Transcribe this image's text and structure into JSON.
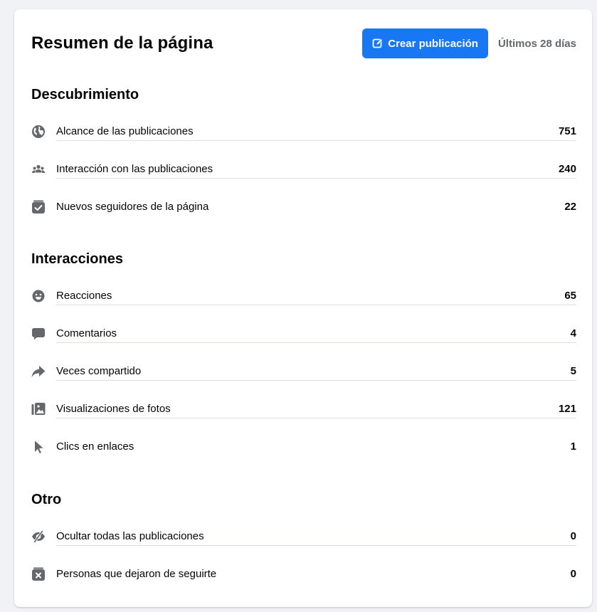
{
  "header": {
    "title": "Resumen de la página",
    "create_button_label": "Crear publicación",
    "period_label": "Últimos 28 días"
  },
  "colors": {
    "accent": "#1877f2",
    "icon": "#65676b",
    "text": "#050505",
    "muted": "#65676b",
    "divider": "#dadde1"
  },
  "sections": [
    {
      "title": "Descubrimiento",
      "rows": [
        {
          "icon": "globe-icon",
          "label": "Alcance de las publicaciones",
          "value": "751"
        },
        {
          "icon": "people-icon",
          "label": "Interacción con las publicaciones",
          "value": "240"
        },
        {
          "icon": "follow-check-icon",
          "label": "Nuevos seguidores de la página",
          "value": "22"
        }
      ]
    },
    {
      "title": "Interacciones",
      "rows": [
        {
          "icon": "smiley-icon",
          "label": "Reacciones",
          "value": "65"
        },
        {
          "icon": "comment-icon",
          "label": "Comentarios",
          "value": "4"
        },
        {
          "icon": "share-arrow-icon",
          "label": "Veces compartido",
          "value": "5"
        },
        {
          "icon": "photos-icon",
          "label": "Visualizaciones de fotos",
          "value": "121"
        },
        {
          "icon": "cursor-icon",
          "label": "Clics en enlaces",
          "value": "1"
        }
      ]
    },
    {
      "title": "Otro",
      "rows": [
        {
          "icon": "eye-hidden-icon",
          "label": "Ocultar todas las publicaciones",
          "value": "0"
        },
        {
          "icon": "unfollow-x-icon",
          "label": "Personas que dejaron de seguirte",
          "value": "0"
        }
      ]
    }
  ]
}
